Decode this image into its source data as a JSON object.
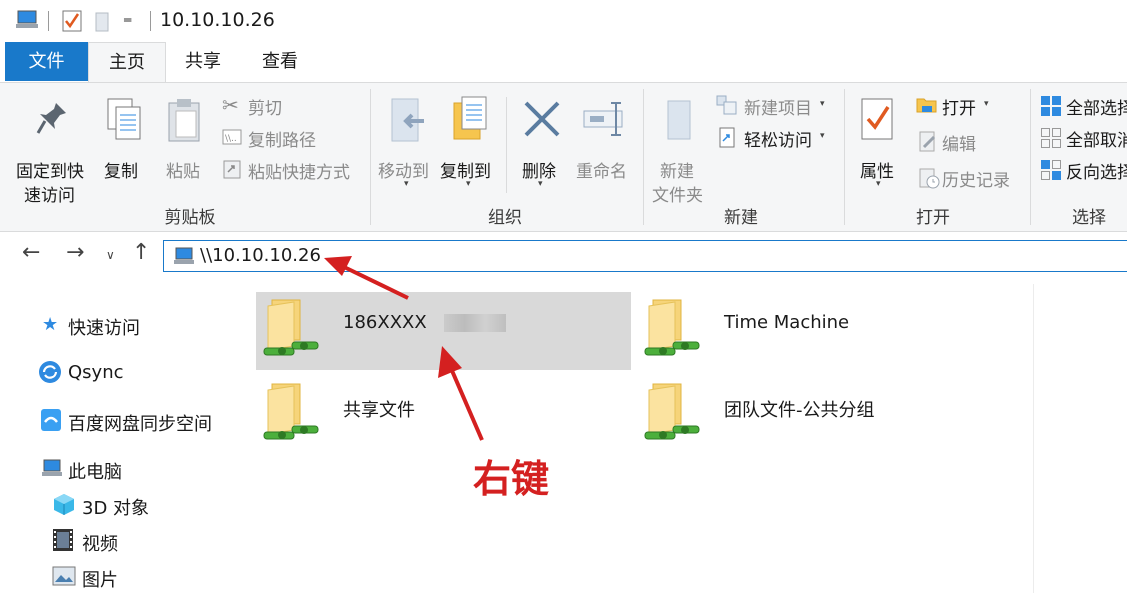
{
  "window": {
    "title": "10.10.10.26"
  },
  "quick_access_toolbar": {
    "icons": [
      "computer-icon",
      "properties-check-icon",
      "new-folder-icon",
      "customize-dropdown-icon"
    ]
  },
  "tabs": [
    {
      "label": "文件"
    },
    {
      "label": "主页"
    },
    {
      "label": "共享"
    },
    {
      "label": "查看"
    }
  ],
  "ribbon": {
    "clipboard": {
      "pin_label_1": "固定到快",
      "pin_label_2": "速访问",
      "copy": "复制",
      "paste": "粘贴",
      "cut": "剪切",
      "copy_path": "复制路径",
      "paste_shortcut": "粘贴快捷方式",
      "group": "剪贴板"
    },
    "organize": {
      "move_to": "移动到",
      "copy_to": "复制到",
      "delete": "删除",
      "rename": "重命名",
      "group": "组织"
    },
    "new": {
      "new_folder_1": "新建",
      "new_folder_2": "文件夹",
      "new_item": "新建项目",
      "easy_access": "轻松访问",
      "group": "新建"
    },
    "open": {
      "properties": "属性",
      "open": "打开",
      "edit": "编辑",
      "history": "历史记录",
      "group": "打开"
    },
    "select": {
      "select_all": "全部选择",
      "select_none": "全部取消",
      "invert": "反向选择",
      "group": "选择"
    }
  },
  "address_bar": {
    "path": "\\\\10.10.10.26"
  },
  "nav_pane": {
    "items": [
      {
        "label": "快速访问",
        "icon": "star-icon"
      },
      {
        "label": "Qsync",
        "icon": "qsync-icon"
      },
      {
        "label": "百度网盘同步空间",
        "icon": "baidu-netdisk-icon"
      },
      {
        "label": "此电脑",
        "icon": "computer-icon"
      },
      {
        "label": "3D 对象",
        "icon": "cube-3d-icon"
      },
      {
        "label": "视频",
        "icon": "video-icon"
      },
      {
        "label": "图片",
        "icon": "picture-icon"
      }
    ]
  },
  "content": {
    "items": [
      {
        "name": "186XXXX",
        "selected": true
      },
      {
        "name": "Time Machine",
        "selected": false
      },
      {
        "name": "共享文件",
        "selected": false
      },
      {
        "name": "团队文件-公共分组",
        "selected": false
      }
    ]
  },
  "annotation": {
    "text": "右键",
    "color": "#d42020"
  },
  "colors": {
    "accent": "#1979ca",
    "ribbon_bg": "#f5f6f7",
    "selection": "#d9d9d9"
  }
}
